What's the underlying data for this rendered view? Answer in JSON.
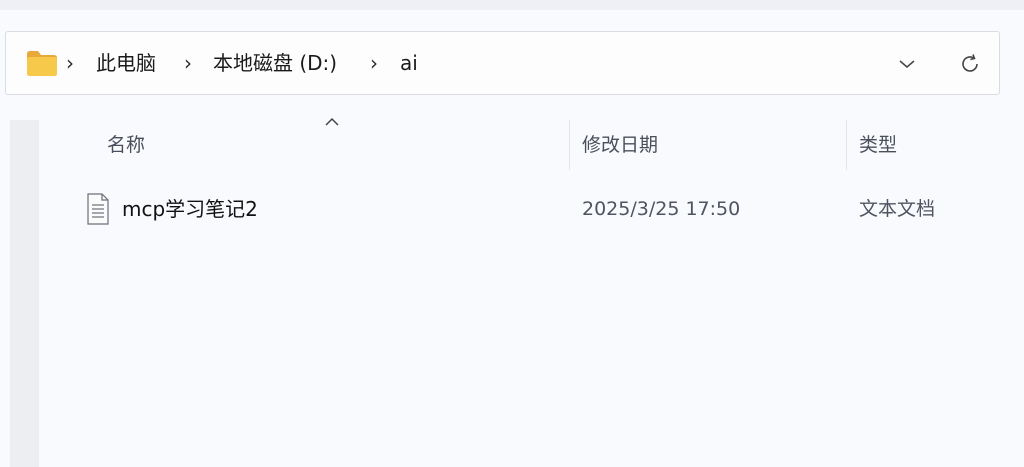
{
  "breadcrumb": {
    "items": [
      "此电脑",
      "本地磁盘 (D:)",
      "ai"
    ],
    "separator": "›"
  },
  "columns": {
    "name": "名称",
    "modified": "修改日期",
    "type": "类型"
  },
  "files": [
    {
      "name": "mcp学习笔记2",
      "modified": "2025/3/25 17:50",
      "type": "文本文档",
      "icon": "text-file-icon"
    }
  ],
  "icons": {
    "folder": "folder-icon",
    "dropdown": "chevron-down-icon",
    "refresh": "refresh-icon",
    "sort": "sort-ascending-caret-icon"
  },
  "colors": {
    "folder_yellow": "#f5c242",
    "background": "#f9fafd",
    "header_text": "#4a4f5c"
  }
}
